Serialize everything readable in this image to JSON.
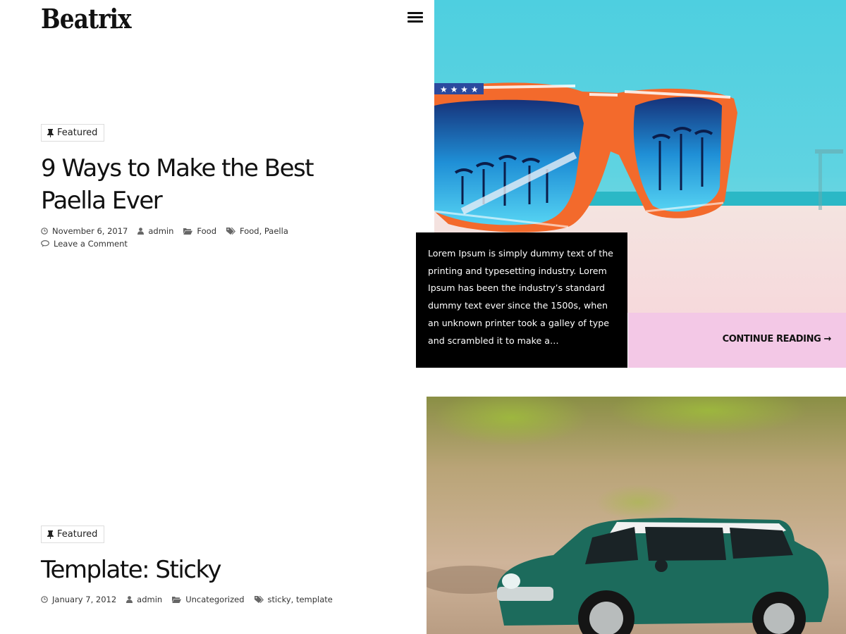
{
  "site": {
    "title": "Beatrix"
  },
  "header": {
    "menu_icon": "hamburger-menu-icon"
  },
  "posts": [
    {
      "badge": "Featured",
      "title_line1": "9 Ways to Make the Best",
      "title_line2": "Paella Ever",
      "date": "November 6, 2017",
      "author": "admin",
      "category": "Food",
      "tags": [
        "Food",
        "Paella"
      ],
      "comments": "Leave a Comment",
      "excerpt": "Lorem Ipsum is simply dummy text of the printing and typesetting industry. Lorem Ipsum has been the industry’s standard dummy text ever since the 1500s, when an unknown printer took a galley of type and scrambled it to make a…",
      "continue_label": "CONTINUE READING →"
    },
    {
      "badge": "Featured",
      "title": "Template: Sticky",
      "date": "January 7, 2012",
      "author": "admin",
      "category": "Uncategorized",
      "tags": [
        "sticky",
        "template"
      ]
    }
  ],
  "colors": {
    "excerpt_bg": "#000000",
    "continue_bg": "#f3c8e6",
    "text": "#111111"
  }
}
